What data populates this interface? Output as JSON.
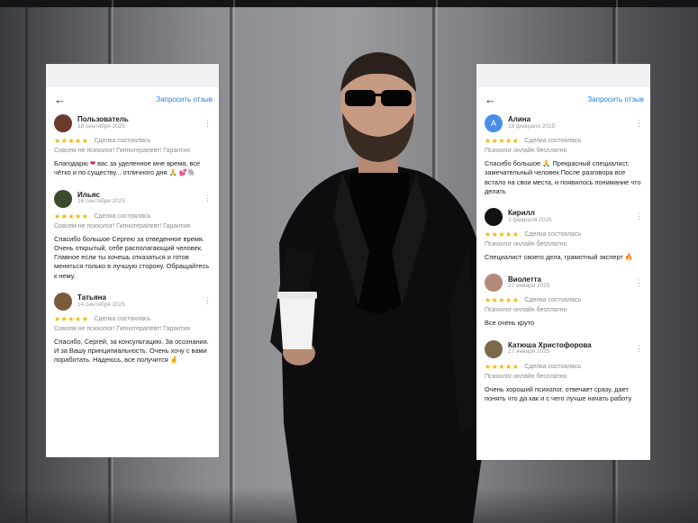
{
  "left_card": {
    "back_icon": "arrow-left-icon",
    "write_review_label": "Запросить отзыв",
    "reviews": [
      {
        "name": "Пользователь",
        "date": "18 сентября 2025",
        "stars": "★★★★★",
        "deal_status": "Сделка состоялась",
        "tags": "Совсем не психолог! Гипнотерапевт! Гарантия",
        "text_before_heart": "Благодарю ",
        "heart": "❤",
        "text_after_heart": " вас за уделенное мне время, все чётко и по существу... отличного дня 🙏 💕🐘",
        "avatar_color": "#6b3a2e"
      },
      {
        "name": "Ильяс",
        "date": "16 сентября 2025",
        "stars": "★★★★★",
        "deal_status": "Сделка состоялась",
        "tags": "Совсем не психолог! Гипнотерапевт! Гарантия",
        "text": "Спасибо большое Сергею за отведенное время. Очень открытый, себе располагающий человек. Главное если ты хочешь отказаться и готов меняться только в лучшую сторону. Обращайтесь к нему.",
        "avatar_color": "#3d4a2c"
      },
      {
        "name": "Татьяна",
        "date": "14 сентября 2025",
        "stars": "★★★★★",
        "deal_status": "Сделка состоялась",
        "tags": "Совсем не психолог! Гипнотерапевт! Гарантия",
        "text": "Спасибо, Сергей, за консультацию. За осознания. И за Вашу принципиальность. Очень хочу с вами поработать. Надеюсь, все получится 🤞",
        "avatar_color": "#7a5a3a"
      }
    ]
  },
  "right_card": {
    "back_icon": "arrow-left-icon",
    "write_review_label": "Запросить отзыв",
    "reviews": [
      {
        "name": "Алина",
        "date": "18 февраля 2025",
        "avatar_letter": "А",
        "stars": "★★★★★",
        "deal_status": "Сделка состоялась",
        "tags": "Психолог онлайн бесплатно",
        "text": "Спасибо большое 🙏 Прекрасный специалист, замечательный человек После разговора все встало на свои места, и появилось понимание что делать",
        "avatar_color": "#4a8fe7"
      },
      {
        "name": "Кирилл",
        "date": "3 февраля 2025",
        "stars": "★★★★★",
        "deal_status": "Сделка состоялась",
        "tags": "Психолог онлайн бесплатно",
        "text": "Специалист своего дела, грамотный эксперт 🔥",
        "avatar_color": "#111111"
      },
      {
        "name": "Виолетта",
        "date": "27 января 2025",
        "stars": "★★★★★",
        "deal_status": "Сделка состоялась",
        "tags": "Психолог онлайн бесплатно",
        "text": "Все очень круто",
        "avatar_color": "#b58a7a"
      },
      {
        "name": "Катюша Христофорова",
        "date": "27 января 2025",
        "stars": "★★★★★",
        "deal_status": "Сделка состоялась",
        "tags": "Психолог онлайн бесплатно",
        "text": "Очень хороший психолог, отвечает сразу, дает понять что да как и с чего лучше начать работу",
        "avatar_color": "#7a6a4a"
      }
    ]
  },
  "colors": {
    "accent_link": "#2a7de1",
    "star": "#f4b400",
    "background_wall": "#8b8c90"
  }
}
